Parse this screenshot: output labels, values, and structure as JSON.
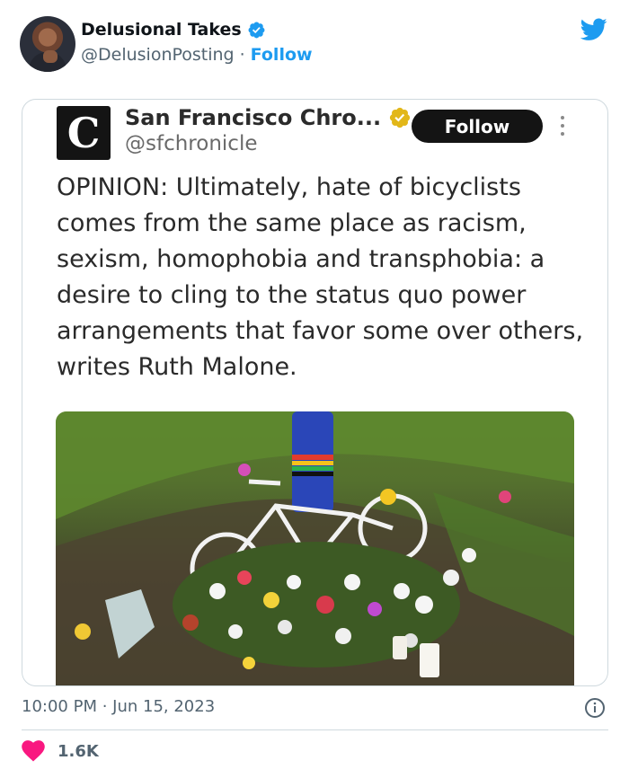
{
  "author": {
    "display_name": "Delusional Takes",
    "handle": "@DelusionPosting",
    "separator": "·",
    "follow_label": "Follow"
  },
  "quoted": {
    "logo_letter": "C",
    "display_name": "San Francisco Chro...",
    "handle": "@sfchronicle",
    "follow_label": "Follow",
    "text": "OPINION: Ultimately, hate of bicyclists comes from the same place as racism, sexism, homophobia and transphobia: a desire to cling to the status quo power arrangements that favor some over others, writes Ruth Malone."
  },
  "footer": {
    "timestamp": "10:00 PM · Jun 15, 2023",
    "like_count": "1.6K"
  },
  "icons": {
    "platform": "twitter-bird-icon",
    "verified": "verified-badge-icon",
    "org_verified": "gold-verified-badge-icon",
    "info": "info-icon",
    "like": "heart-icon"
  },
  "colors": {
    "brand_blue": "#1d9bf0",
    "heart": "#f91880",
    "muted": "#536471",
    "gold": "#e2b719"
  }
}
